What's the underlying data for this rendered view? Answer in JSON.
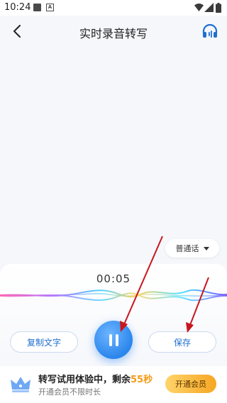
{
  "status_bar": {
    "time": "10:24",
    "badge_letter": "A"
  },
  "header": {
    "title": "实时录音转写"
  },
  "language": {
    "selected": "普通话"
  },
  "recording": {
    "timer": "00:05"
  },
  "controls": {
    "copy_label": "复制文字",
    "save_label": "保存"
  },
  "promo": {
    "line1_prefix": "转写试用体验中，剩余",
    "line1_value": "55秒",
    "line2": "开通会员不限时长",
    "vip_button": "开通会员"
  },
  "colors": {
    "accent_blue": "#2b86ec",
    "link_blue": "#1f6fd1",
    "highlight_orange": "#f39a14",
    "annotation_red": "#c8161d"
  },
  "icons": [
    "back-arrow-icon",
    "headphone-icon",
    "dropdown-arrow-icon",
    "pause-icon",
    "crown-icon",
    "wifi-icon",
    "signal-icon",
    "battery-icon"
  ]
}
